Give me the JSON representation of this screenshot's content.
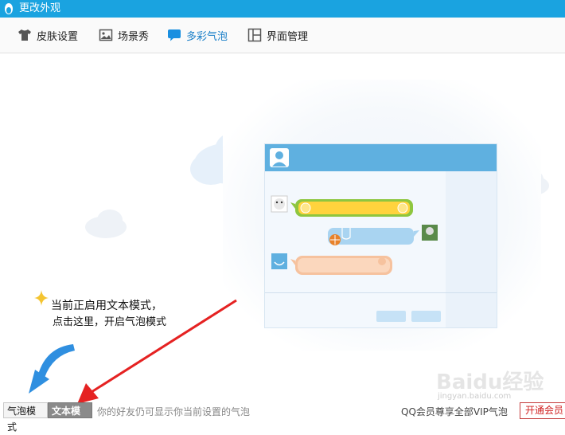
{
  "window": {
    "title": "更改外观"
  },
  "tabs": [
    {
      "label": "皮肤设置",
      "icon": "shirt-icon"
    },
    {
      "label": "场景秀",
      "icon": "picture-icon"
    },
    {
      "label": "多彩气泡",
      "icon": "chat-bubble-icon",
      "active": true
    },
    {
      "label": "界面管理",
      "icon": "layout-icon"
    }
  ],
  "hint": {
    "line1": "当前正启用文本模式，",
    "line2": "点击这里，开启气泡模式"
  },
  "bottom": {
    "bubble_mode": "气泡模式",
    "text_mode": "文本模式",
    "tip": "你的好友仍可显示你当前设置的气泡",
    "vip_text": "QQ会员尊享全部VIP气泡",
    "open_vip": "开通会员"
  },
  "watermark": {
    "logo": "Baidu经验",
    "url": "jingyan.baidu.com"
  },
  "colors": {
    "accent": "#1aa3e0",
    "active_tab": "#1a7fc8",
    "arrow": "#e52222",
    "blue_arrow": "#2f8fe0"
  }
}
